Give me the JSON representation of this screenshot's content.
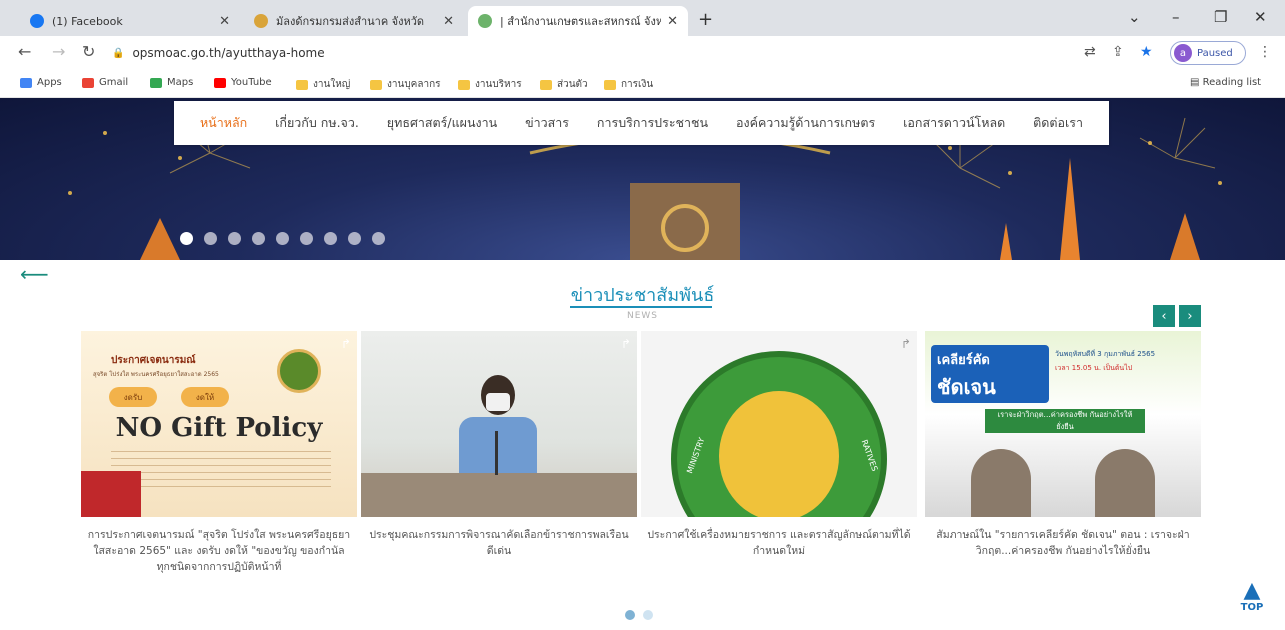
{
  "browser": {
    "tabs": [
      {
        "title": "(1) Facebook",
        "color": "#1877f2",
        "active": false
      },
      {
        "title": "มัลงด้กรมกรมส่งสำนาค จังหวัด",
        "color": "#d9a43a",
        "active": false
      },
      {
        "title": "| สำนักงานเกษตรและสหกรณ์ จังหวัด",
        "color": "#6db36b",
        "active": true
      }
    ],
    "address": "opsmoac.go.th/ayutthaya-home",
    "profile_label": "Paused",
    "profile_initial": "a",
    "bookmarks": [
      {
        "label": "Apps",
        "color": "#4285f4"
      },
      {
        "label": "Gmail",
        "color": "#ea4335"
      },
      {
        "label": "Maps",
        "color": "#34a853"
      },
      {
        "label": "YouTube",
        "color": "#ff0000"
      },
      {
        "label": "งานใหญ่",
        "color": "#f5c542"
      },
      {
        "label": "งานบุคลากร",
        "color": "#f5c542"
      },
      {
        "label": "งานบริหาร",
        "color": "#f5c542"
      },
      {
        "label": "ส่วนตัว",
        "color": "#f5c542"
      },
      {
        "label": "การเงิน",
        "color": "#f5c542"
      }
    ],
    "reading_list": "Reading list"
  },
  "site": {
    "nav": [
      "หน้าหลัก",
      "เกี่ยวกับ กษ.จว.",
      "ยุทธศาสตร์/แผนงาน",
      "ข่าวสาร",
      "การบริการประชาชน",
      "องค์ความรู้ด้านการเกษตร",
      "เอกสารดาวน์โหลด",
      "ติดต่อเรา"
    ],
    "active_nav": 0,
    "slider_dots": 9,
    "slider_active": 0,
    "section_title": "ข่าวประชาสัมพันธ์",
    "section_subtitle": "NEWS",
    "cards": [
      {
        "caption": "การประกาศเจตนารมณ์ \"สุจริต โปร่งใส พระนครศรีอยุธยาใสสะอาด 2565\" และ งดรับ งดให้ \"ของขวัญ ของกำนัลทุกชนิดจากการปฏิบัติหน้าที่",
        "img_header": "ประกาศเจตนารมณ์",
        "img_sub": "สุจริต โปร่งใส พระนครศรีอยุธยาใสสะอาด 2565",
        "img_tag1": "งดรับ",
        "img_tag2": "งดให้",
        "img_text": "NO Gift Policy"
      },
      {
        "caption": "ประชุมคณะกรรมการพิจารณาคัดเลือกข้าราชการพลเรือนดีเด่น"
      },
      {
        "caption": "ประกาศใช้เครื่องหมายราชการ และตราสัญลักษณ์ตามที่ได้กำหนดใหม่",
        "img_left": "MINISTRY",
        "img_right": "RATIVES"
      },
      {
        "caption": "สัมภาษณ์ใน \"รายการเคลียร์คัด ชัดเจน\" ตอน : เราจะฝ่าวิกฤต...ค่าครองชีพ กันอย่างไรให้ยั่งยืน",
        "img_brand1": "เคลียร์คัด",
        "img_brand2": "ชัดเจน",
        "img_banner": "เราจะฝ่าวิกฤต...ค่าครองชีพ กันอย่างไรให้ยั่งยืน",
        "img_date": "วันพฤหัสบดีที่ 3 กุมภาพันธ์ 2565",
        "img_time": "เวลา 15.05 น. เป็นต้นไป"
      }
    ],
    "pager_dots": 2,
    "top_label": "TOP"
  }
}
